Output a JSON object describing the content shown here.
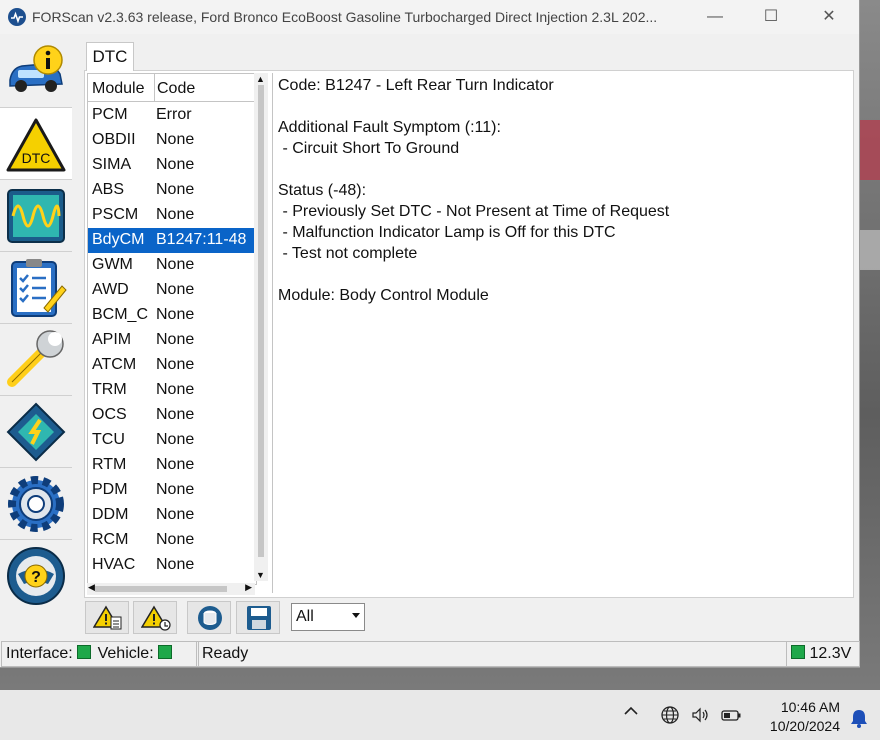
{
  "window": {
    "title": "FORScan v2.3.63 release, Ford Bronco EcoBoost Gasoline Turbocharged Direct Injection 2.3L 202...",
    "controls": {
      "minimize": "—",
      "maximize": "☐",
      "close": "✕"
    }
  },
  "sidebar": {
    "items": [
      {
        "name": "vehicle-info",
        "icon": "car-info-icon",
        "active": false
      },
      {
        "name": "dtc",
        "icon": "dtc-warning-icon",
        "active": true,
        "label": "DTC"
      },
      {
        "name": "oscilloscope",
        "icon": "oscilloscope-icon",
        "active": false
      },
      {
        "name": "tests",
        "icon": "clipboard-checklist-icon",
        "active": false
      },
      {
        "name": "service",
        "icon": "wrench-icon",
        "active": false
      },
      {
        "name": "configuration",
        "icon": "chip-icon",
        "active": false
      },
      {
        "name": "settings",
        "icon": "gear-icon",
        "active": false
      },
      {
        "name": "help",
        "icon": "steering-help-icon",
        "active": false
      }
    ]
  },
  "tabs": [
    {
      "label": "DTC"
    }
  ],
  "dtc_list": {
    "headers": {
      "module": "Module",
      "code": "Code"
    },
    "rows": [
      {
        "module": "PCM",
        "code": "Error"
      },
      {
        "module": "OBDII",
        "code": "None"
      },
      {
        "module": "SIMA",
        "code": "None"
      },
      {
        "module": "ABS",
        "code": "None"
      },
      {
        "module": "PSCM",
        "code": "None"
      },
      {
        "module": "BdyCM",
        "code": "B1247:11-48",
        "selected": true
      },
      {
        "module": "GWM",
        "code": "None"
      },
      {
        "module": "AWD",
        "code": "None"
      },
      {
        "module": "BCM_C",
        "code": "None"
      },
      {
        "module": "APIM",
        "code": "None"
      },
      {
        "module": "ATCM",
        "code": "None"
      },
      {
        "module": "TRM",
        "code": "None"
      },
      {
        "module": "OCS",
        "code": "None"
      },
      {
        "module": "TCU",
        "code": "None"
      },
      {
        "module": "RTM",
        "code": "None"
      },
      {
        "module": "PDM",
        "code": "None"
      },
      {
        "module": "DDM",
        "code": "None"
      },
      {
        "module": "RCM",
        "code": "None"
      },
      {
        "module": "HVAC",
        "code": "None"
      }
    ]
  },
  "details": {
    "code_line": "Code: B1247 - Left Rear Turn Indicator",
    "symptom_title": "Additional Fault Symptom (:11):",
    "symptom_1": " - Circuit Short To Ground",
    "status_title": "Status (-48):",
    "status_1": " - Previously Set DTC - Not Present at Time of Request",
    "status_2": " - Malfunction Indicator Lamp is Off for this DTC",
    "status_3": " - Test not complete",
    "module_line": "Module: Body Control Module"
  },
  "toolbar": {
    "buttons": [
      "read-dtc-report-icon",
      "clear-dtc-icon",
      "database-icon",
      "save-icon"
    ],
    "filter_value": "All"
  },
  "statusbar": {
    "interface_label": "Interface:",
    "vehicle_label": "Vehicle:",
    "state": "Ready",
    "voltage": "12.3V",
    "led_color": "#1fa84a"
  },
  "taskbar": {
    "time": "10:46 AM",
    "date": "10/20/2024"
  }
}
